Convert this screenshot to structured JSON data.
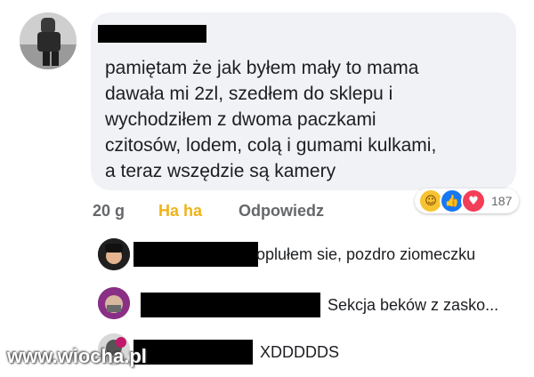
{
  "comment": {
    "lines": [
      "pamiętam że jak byłem mały to mama",
      "dawała mi 2zl, szedłem do sklepu i",
      "wychodziłem z dwoma paczkami",
      "czitosów, lodem, colą i gumami kulkami,",
      "a teraz wszędzie są kamery"
    ],
    "time": "20 g",
    "reaction_label": "Ha ha",
    "reply_label": "Odpowiedz",
    "reaction_count": "187",
    "reaction_icons": [
      "haha-icon",
      "like-icon",
      "love-icon"
    ]
  },
  "replies": [
    {
      "text": "oplułem sie, pozdro ziomeczku"
    },
    {
      "text": "Sekcja beków z zasko..."
    },
    {
      "text": "XDDDDDS"
    }
  ],
  "watermark": "www.wiocha.pl",
  "colors": {
    "bubble": "#f0f2f5",
    "haha": "#f0b318",
    "muted": "#65676b",
    "like": "#1877f2",
    "love": "#f33e58"
  }
}
